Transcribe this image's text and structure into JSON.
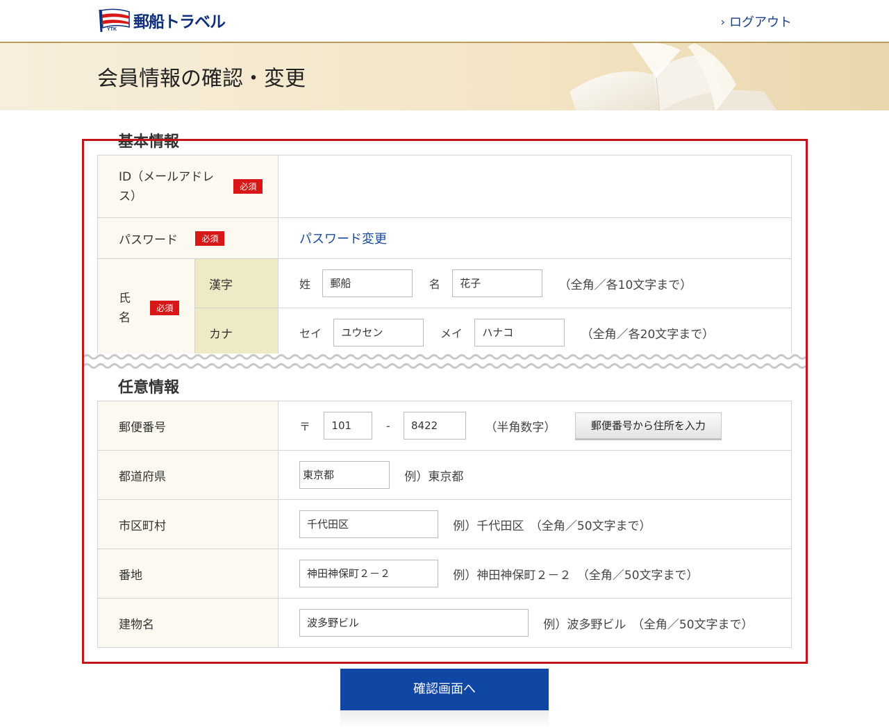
{
  "header": {
    "logo_text": "郵船トラベル",
    "logo_mark": "YTK",
    "logout_label": "ログアウト"
  },
  "banner": {
    "title": "会員情報の確認・変更"
  },
  "basic": {
    "title": "基本情報",
    "required_label": "必須",
    "id_label": "ID（メールアドレス）",
    "password_label": "パスワード",
    "password_link": "パスワード変更",
    "name_label": "氏名",
    "kanji_label": "漢字",
    "kana_label": "カナ",
    "sei_label": "姓",
    "mei_label": "名",
    "sei_value": "郵船",
    "mei_value": "花子",
    "kanji_note": "（全角／各10文字まで）",
    "kana_sei_label": "セイ",
    "kana_mei_label": "メイ",
    "kana_sei_value": "ユウセン",
    "kana_mei_value": "ハナコ",
    "kana_note": "（全角／各20文字まで）"
  },
  "optional": {
    "title": "任意情報",
    "zip_label": "郵便番号",
    "zip_mark": "〒",
    "zip1": "101",
    "zip_sep": "-",
    "zip2": "8422",
    "zip_note": "（半角数字）",
    "zip_button": "郵便番号から住所を入力",
    "pref_label": "都道府県",
    "pref_value": "東京都",
    "pref_example": "例）東京都",
    "city_label": "市区町村",
    "city_value": "千代田区",
    "city_example": "例）千代田区　（全角／50文字まで）",
    "addr_label": "番地",
    "addr_value": "神田神保町２－２",
    "addr_example": "例）神田神保町２－２　（全角／50文字まで）",
    "bldg_label": "建物名",
    "bldg_value": "波多野ビル",
    "bldg_example": "例）波多野ビル　（全角／50文字まで）"
  },
  "submit_label": "確認画面へ",
  "colors": {
    "accent": "#1147a4",
    "required": "#d71718",
    "frame": "#c0151b",
    "link": "#1b4b9a"
  }
}
